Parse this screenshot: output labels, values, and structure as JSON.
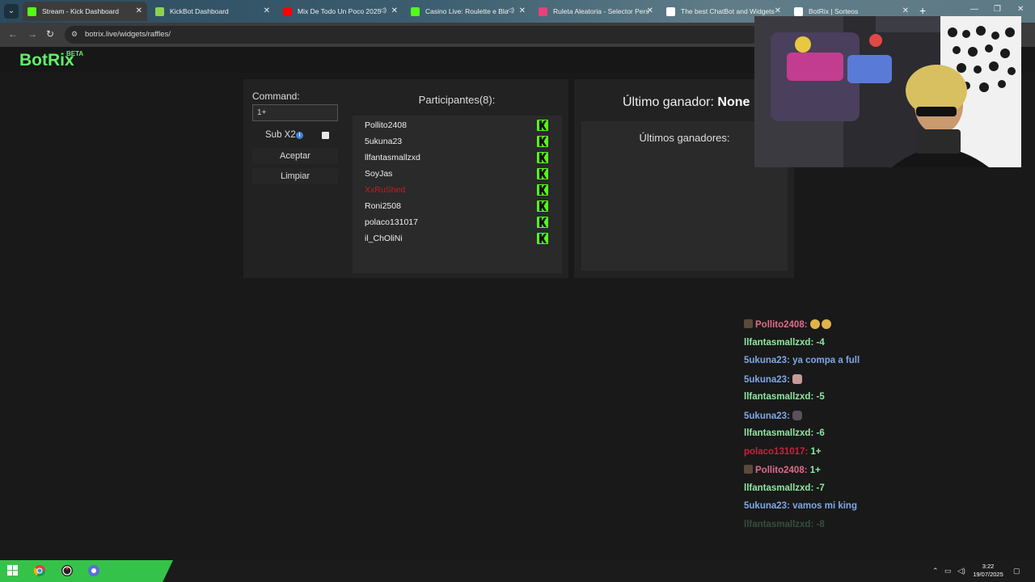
{
  "browser": {
    "tabs": [
      {
        "title": "Stream - Kick Dashboard",
        "active": true,
        "icon": "kick-icon",
        "color": "#53fc18",
        "has_audio": false
      },
      {
        "title": "KickBot Dashboard",
        "active": false,
        "icon": "kickbot-icon",
        "color": "#8fd14f",
        "has_audio": false
      },
      {
        "title": "Mix De Todo Un Poco 2025",
        "active": false,
        "icon": "youtube-icon",
        "color": "#ff0000",
        "has_audio": true
      },
      {
        "title": "Casino Live: Roulette e Bla",
        "active": false,
        "icon": "casino-icon",
        "color": "#53fc18",
        "has_audio": true
      },
      {
        "title": "Ruleta Aleatoria - Selector Pers",
        "active": false,
        "icon": "ruleta-icon",
        "color": "#e9407a",
        "has_audio": false
      },
      {
        "title": "The best ChatBot and Widgets",
        "active": false,
        "icon": "botrix-icon",
        "color": "#ffffff",
        "has_audio": false
      },
      {
        "title": "BotRix | Sorteos",
        "active": false,
        "icon": "botrix-icon",
        "color": "#ffffff",
        "has_audio": false
      }
    ],
    "url": "botrix.live/widgets/raffles/"
  },
  "app": {
    "logo": "BotRix",
    "badge": "BETA",
    "brand_color": "#5ef26a"
  },
  "raffle": {
    "command_label": "Command:",
    "command_value": "1+",
    "sub_label": "Sub X2",
    "sub_checked": false,
    "accept_label": "Aceptar",
    "clear_label": "Limpiar"
  },
  "participants": {
    "title": "Participantes(8):",
    "rows": [
      {
        "name": "Pollito2408",
        "highlight": false
      },
      {
        "name": "5ukuna23",
        "highlight": false
      },
      {
        "name": "llfantasmallzxd",
        "highlight": false
      },
      {
        "name": "SoyJas",
        "highlight": false
      },
      {
        "name": "XxRuShed",
        "highlight": true
      },
      {
        "name": "Roni2508",
        "highlight": false
      },
      {
        "name": "polaco131017",
        "highlight": false
      },
      {
        "name": "il_ChOliNi",
        "highlight": false
      }
    ],
    "platform_icon": "kick-icon",
    "platform_color": "#53fc18"
  },
  "winners": {
    "last_label": "Último ganador:",
    "last_value": "None",
    "history_title": "Últimos ganadores:"
  },
  "chat": [
    {
      "user": "Pollito2408",
      "color": "#e06b8a",
      "badge": true,
      "text": "",
      "emotes": [
        "face",
        "face"
      ]
    },
    {
      "user": "llfantasmallzxd",
      "color": "#8fe6a0",
      "badge": false,
      "text": "-4",
      "emotes": []
    },
    {
      "user": "5ukuna23",
      "color": "#7fa8e6",
      "badge": false,
      "text": "ya compa a full",
      "emotes": []
    },
    {
      "user": "5ukuna23",
      "color": "#7fa8e6",
      "badge": false,
      "text": "",
      "emotes": [
        "pink"
      ]
    },
    {
      "user": "llfantasmallzxd",
      "color": "#8fe6a0",
      "badge": false,
      "text": "-5",
      "emotes": []
    },
    {
      "user": "5ukuna23",
      "color": "#7fa8e6",
      "badge": false,
      "text": "",
      "emotes": [
        "dark"
      ]
    },
    {
      "user": "llfantasmallzxd",
      "color": "#8fe6a0",
      "badge": false,
      "text": "-6",
      "emotes": []
    },
    {
      "user": "polaco131017",
      "color": "#d81b3c",
      "badge": false,
      "text": "1+",
      "emotes": []
    },
    {
      "user": "Pollito2408",
      "color": "#e06b8a",
      "badge": true,
      "text": "1+",
      "emotes": []
    },
    {
      "user": "llfantasmallzxd",
      "color": "#8fe6a0",
      "badge": false,
      "text": "-7",
      "emotes": []
    },
    {
      "user": "5ukuna23",
      "color": "#7fa8e6",
      "badge": false,
      "text": "vamos mi king",
      "emotes": []
    },
    {
      "user": "llfantasmallzxd",
      "color": "#8fe6a0",
      "badge": false,
      "text": "-8",
      "emotes": []
    }
  ],
  "taskbar": {
    "time": "3:22",
    "date": "19/07/2025"
  }
}
